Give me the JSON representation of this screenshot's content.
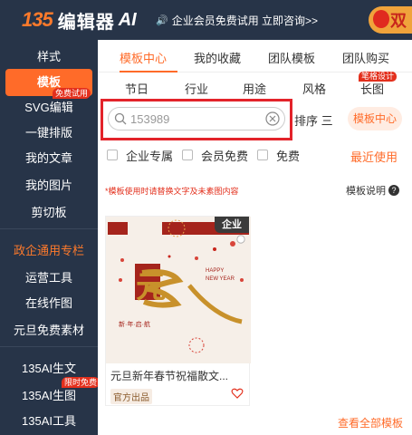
{
  "header": {
    "logo_mark": "135",
    "logo_text": "编辑器",
    "logo_ai": "AI",
    "announcement": "企业会员免费试用 立即咨询>>",
    "promo": "双"
  },
  "sidebar": {
    "items": [
      {
        "label": "样式"
      },
      {
        "label": "模板",
        "tag": "免费试用"
      },
      {
        "label": "SVG编辑"
      },
      {
        "label": "一键排版"
      },
      {
        "label": "我的文章"
      },
      {
        "label": "我的图片"
      },
      {
        "label": "剪切板"
      },
      {
        "label": "政企通用专栏"
      },
      {
        "label": "运营工具"
      },
      {
        "label": "在线作图"
      },
      {
        "label": "元旦免费素材"
      },
      {
        "label": "135AI生文"
      },
      {
        "label": "135AI生图",
        "tag": "限时免费"
      },
      {
        "label": "135AI工具"
      }
    ]
  },
  "tabs": [
    "模板中心",
    "我的收藏",
    "团队模板",
    "团队购买"
  ],
  "subtabs": [
    "节日",
    "行业",
    "用途",
    "风格",
    "长图"
  ],
  "subtab_hot_tag": "笔格设计",
  "search": {
    "placeholder": "153989"
  },
  "sort_label": "排序 三",
  "template_center_button": "模板中心",
  "filters": [
    "企业专属",
    "会员免费",
    "免费"
  ],
  "recent_link": "最近使用",
  "notice": "*模板使用时请替换文字及未素图内容",
  "guide": "模板说明",
  "card": {
    "badge": "企业",
    "poster_main": "元",
    "poster_sub": "新·年·启·航",
    "poster_en": "HAPPY\nNEW YEAR",
    "title": "元旦新年春节祝福散文...",
    "official": "官方出品"
  },
  "view_all": "查看全部模板",
  "colors": {
    "accent": "#ff6b29",
    "sidebar_bg": "#273448",
    "highlight": "#e3232a"
  }
}
